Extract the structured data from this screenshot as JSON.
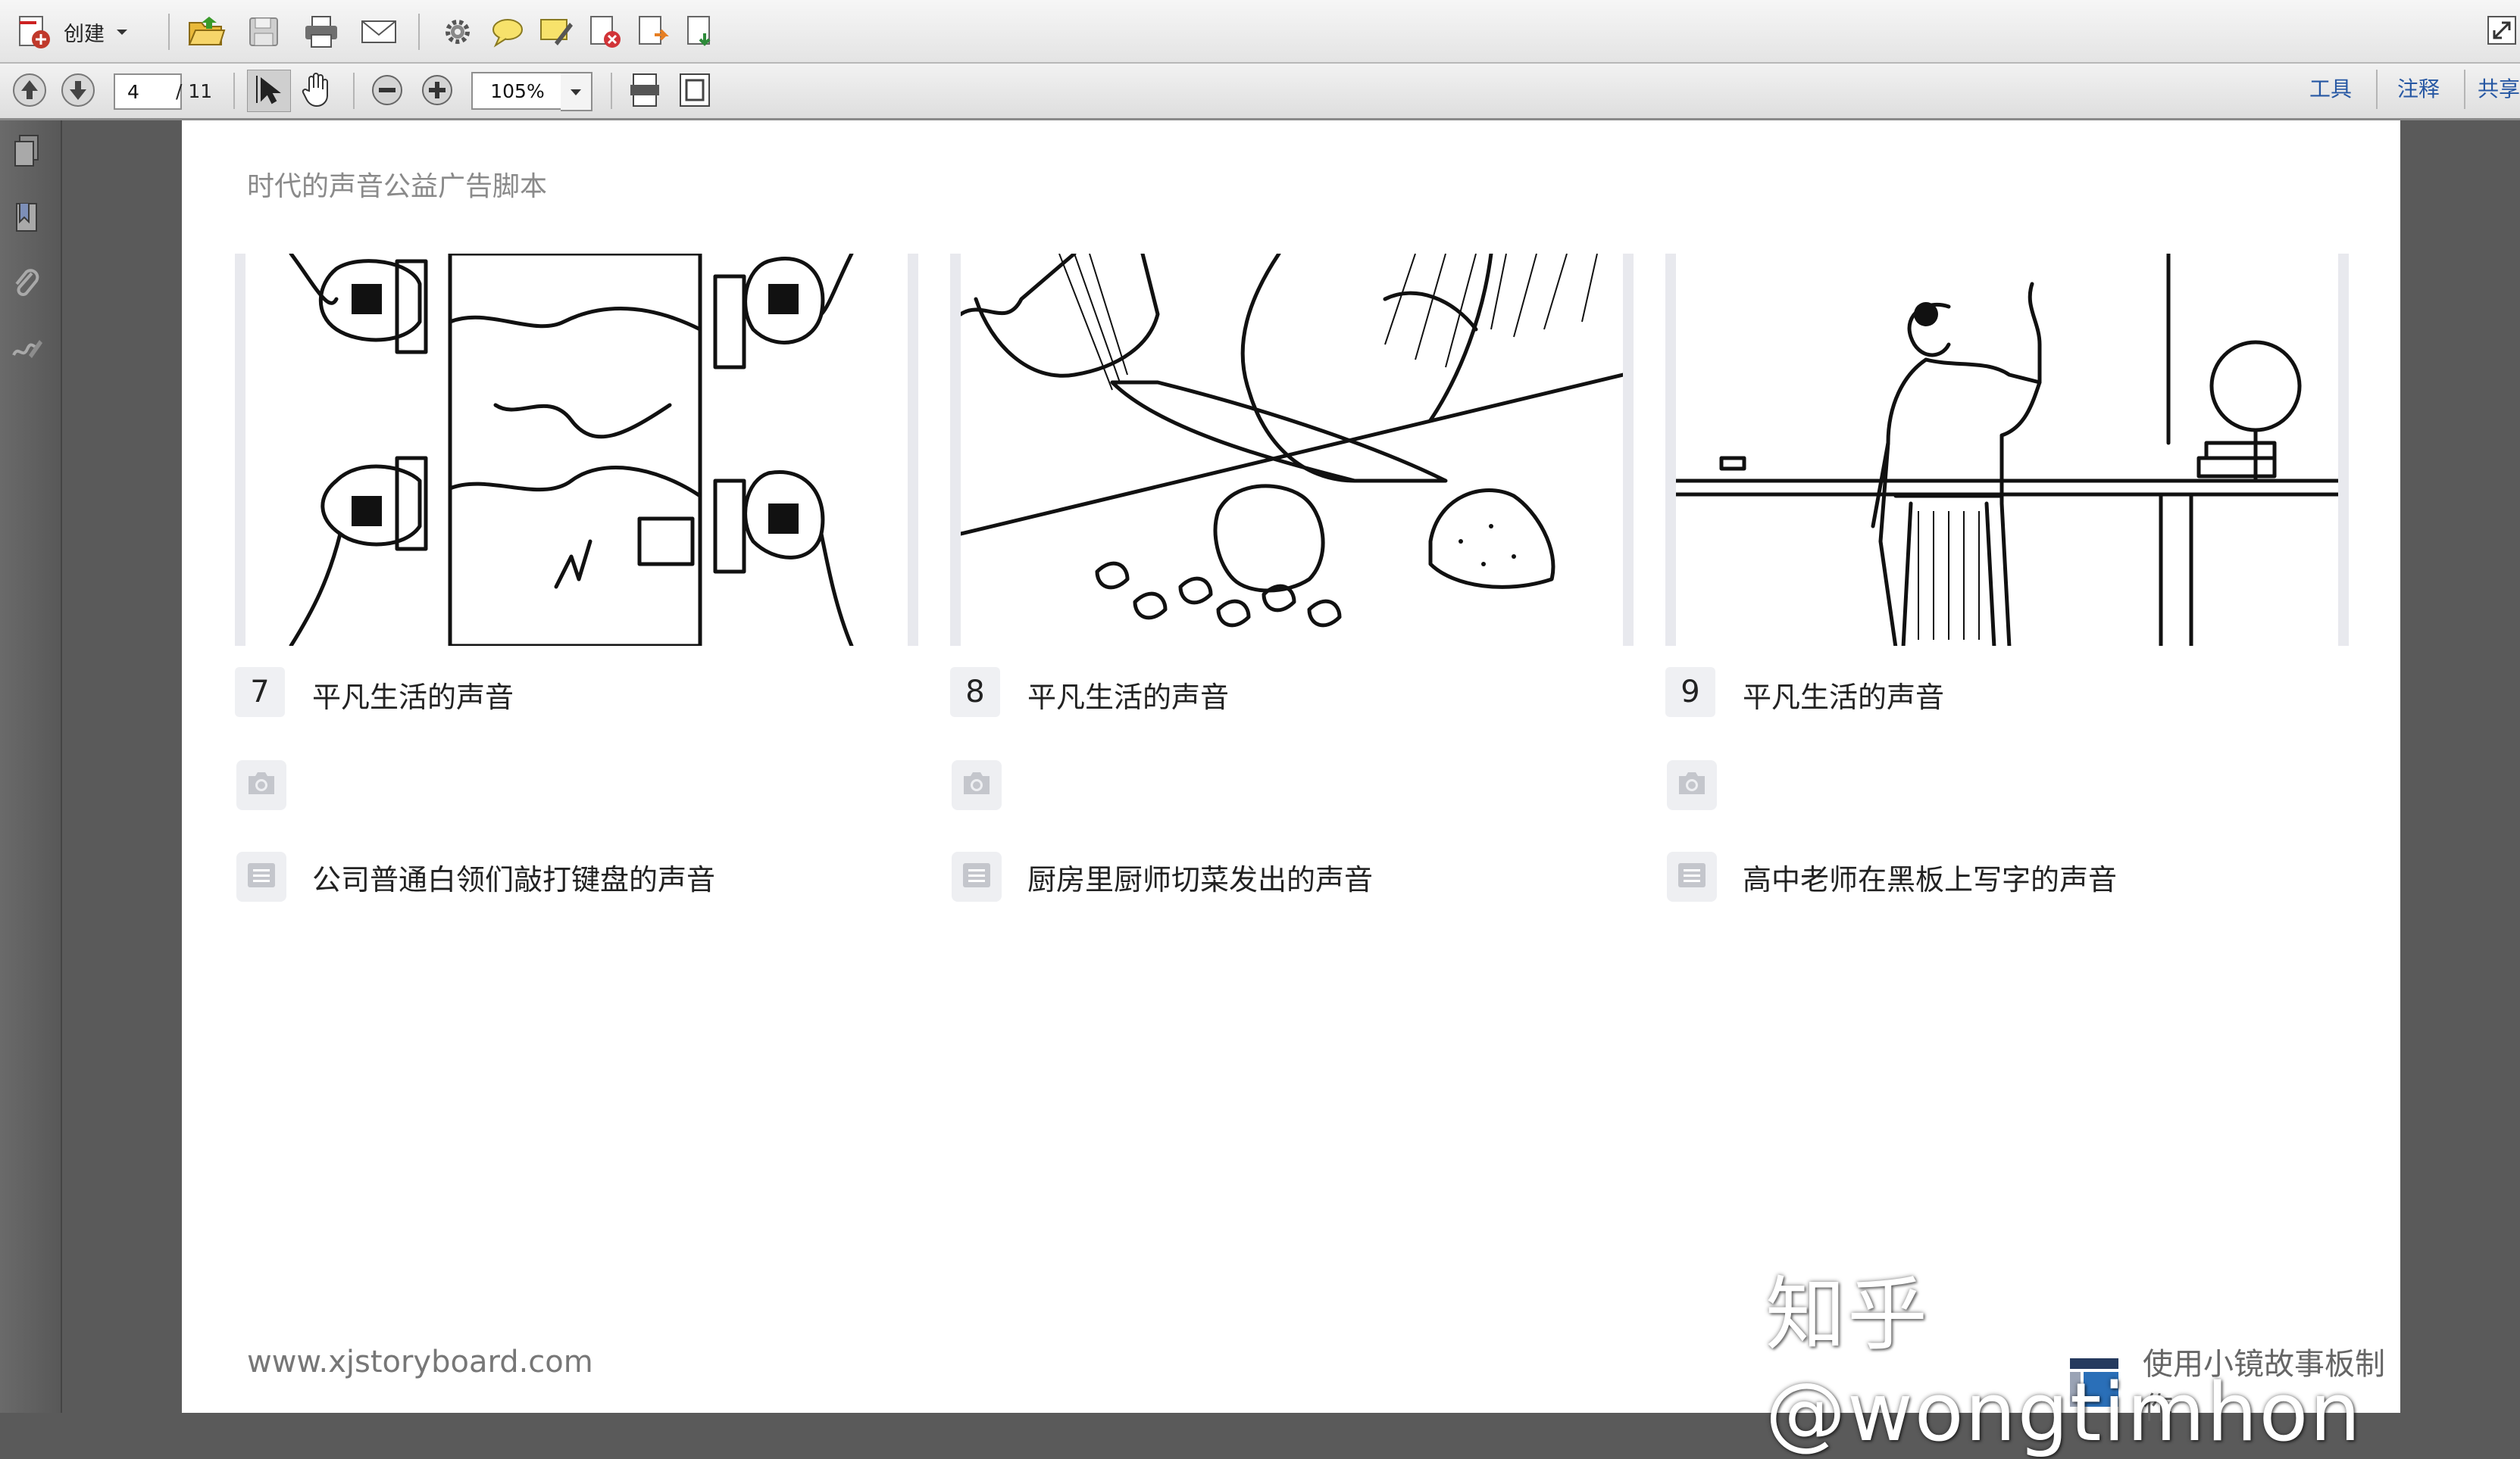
{
  "toolbar": {
    "create_label": "创建",
    "page_current": "4",
    "page_total": "/ 11",
    "zoom": "105%",
    "tabs": [
      "工具",
      "注释",
      "共享"
    ]
  },
  "document": {
    "title": "时代的声音公益广告脚本",
    "footer_url": "www.xjstoryboard.com",
    "brand": "使用小镜故事板制作"
  },
  "shots": [
    {
      "number": "7",
      "title": "平凡生活的声音",
      "description": "公司普通白领们敲打键盘的声音"
    },
    {
      "number": "8",
      "title": "平凡生活的声音",
      "description": "厨房里厨师切菜发出的声音"
    },
    {
      "number": "9",
      "title": "平凡生活的声音",
      "description": "高中老师在黑板上写字的声音"
    }
  ],
  "watermark": "知乎 @wongtimhon",
  "icons": {
    "toolbar_row1": [
      "create-pdf-icon",
      "open-folder-icon",
      "save-icon",
      "print-icon",
      "email-icon",
      "settings-icon",
      "comment-icon",
      "highlight-icon",
      "delete-icon",
      "export-icon",
      "import-icon",
      "expand-icon"
    ],
    "toolbar_row2": [
      "page-up-icon",
      "page-down-icon",
      "select-tool-icon",
      "hand-tool-icon",
      "zoom-out-icon",
      "zoom-in-icon",
      "fit-width-icon",
      "fit-page-icon"
    ],
    "sidebar": [
      "pages-icon",
      "bookmark-icon",
      "attachment-icon",
      "signature-icon"
    ],
    "shot": [
      "camera-icon",
      "text-lines-icon"
    ]
  }
}
